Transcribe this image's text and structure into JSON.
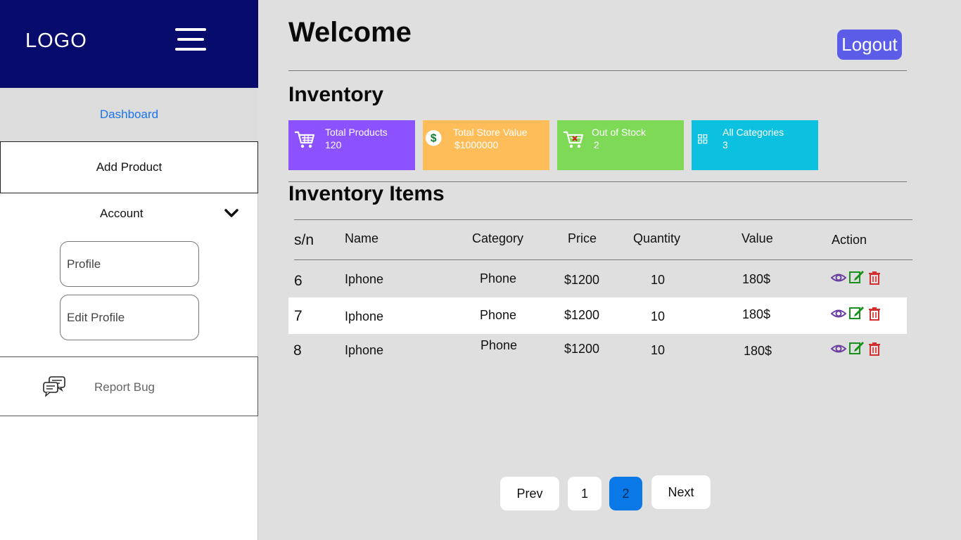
{
  "sidebar": {
    "logo": "LOGO",
    "dashboard": "Dashboard",
    "add_product": "Add Product",
    "account": "Account",
    "profile": "Profile",
    "edit_profile": "Edit Profile",
    "report_bug": "Report Bug"
  },
  "header": {
    "title": "Welcome",
    "logout": "Logout"
  },
  "inventory": {
    "title": "Inventory",
    "cards": [
      {
        "label": "Total Products",
        "value": "120",
        "icon": "cart-icon",
        "color": "#8c52ff"
      },
      {
        "label": "Total Store Value",
        "value": "$1000000",
        "icon": "dollar-icon",
        "color": "#ffbd59"
      },
      {
        "label": "Out of Stock",
        "value": "2",
        "icon": "cart-x-icon",
        "color": "#7ed957"
      },
      {
        "label": "All Categories",
        "value": "3",
        "icon": "grid-icon",
        "color": "#0cc0df"
      }
    ]
  },
  "items": {
    "title": "Inventory Items",
    "columns": [
      "s/n",
      "Name",
      "Category",
      "Price",
      "Quantity",
      "Value",
      "Action"
    ],
    "rows": [
      {
        "sn": "6",
        "name": "Iphone",
        "category": "Phone",
        "price": "$1200",
        "quantity": "10",
        "value": "180$"
      },
      {
        "sn": "7",
        "name": "Iphone",
        "category": "Phone",
        "price": "$1200",
        "quantity": "10",
        "value": "180$"
      },
      {
        "sn": "8",
        "name": "Iphone",
        "category": "Phone",
        "price": "$1200",
        "quantity": "10",
        "value": "180$"
      }
    ]
  },
  "pagination": {
    "prev": "Prev",
    "pages": [
      "1",
      "2"
    ],
    "current": "2",
    "next": "Next"
  },
  "colors": {
    "brand": "#070b6b",
    "accent": "#5b5ce8",
    "active_page": "#0a78e6",
    "view_icon": "#6b3fa0",
    "edit_icon": "#17911b",
    "delete_icon": "#d32f2f"
  }
}
